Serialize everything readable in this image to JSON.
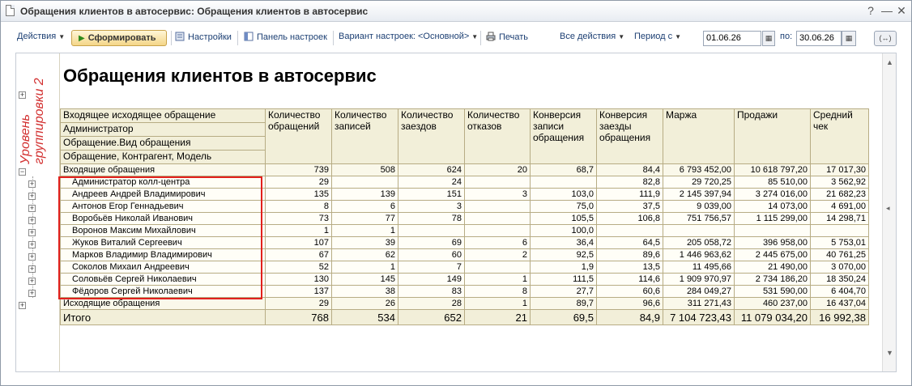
{
  "window": {
    "title": "Обращения клиентов в автосервис: Обращения клиентов в автосервис"
  },
  "toolbar": {
    "actions": "Действия",
    "form": "Сформировать",
    "settings": "Настройки",
    "panel": "Панель настроек",
    "variant": "Вариант настроек: <Основной>",
    "print": "Печать",
    "all_actions": "Все действия",
    "period_from_label": "Период с",
    "date_from": "01.06.26",
    "to_label": "по:",
    "date_to": "30.06.26"
  },
  "annotation": {
    "line1": "Уровень",
    "line2": "группировки 2"
  },
  "report": {
    "title": "Обращения клиентов в автосервис",
    "row_headers": [
      "Входящее исходящее обращение",
      "Администратор",
      "Обращение.Вид обращения",
      "Обращение, Контрагент, Модель"
    ],
    "columns": [
      "Количество обращений",
      "Количество записей",
      "Количество заездов",
      "Количество отказов",
      "Конверсия записи обращения",
      "Конверсия заезды обращения",
      "Маржа",
      "Продажи",
      "Средний чек"
    ],
    "incoming": {
      "label": "Входящие обращения",
      "values": [
        "739",
        "508",
        "624",
        "20",
        "68,7",
        "84,4",
        "6 793 452,00",
        "10 618 797,20",
        "17 017,30"
      ]
    },
    "rows": [
      {
        "label": "Администратор колл-центра",
        "values": [
          "29",
          "",
          "24",
          "",
          "",
          "82,8",
          "29 720,25",
          "85 510,00",
          "3 562,92"
        ]
      },
      {
        "label": "Андреев Андрей Владимирович",
        "values": [
          "135",
          "139",
          "151",
          "3",
          "103,0",
          "111,9",
          "2 145 397,94",
          "3 274 016,00",
          "21 682,23"
        ]
      },
      {
        "label": "Антонов Егор Геннадьевич",
        "values": [
          "8",
          "6",
          "3",
          "",
          "75,0",
          "37,5",
          "9 039,00",
          "14 073,00",
          "4 691,00"
        ]
      },
      {
        "label": "Воробьёв Николай Иванович",
        "values": [
          "73",
          "77",
          "78",
          "",
          "105,5",
          "106,8",
          "751 756,57",
          "1 115 299,00",
          "14 298,71"
        ]
      },
      {
        "label": "Воронов Максим Михайлович",
        "values": [
          "1",
          "1",
          "",
          "",
          "100,0",
          "",
          "",
          "",
          ""
        ]
      },
      {
        "label": "Жуков Виталий Сергеевич",
        "values": [
          "107",
          "39",
          "69",
          "6",
          "36,4",
          "64,5",
          "205 058,72",
          "396 958,00",
          "5 753,01"
        ]
      },
      {
        "label": "Марков Владимир Владимирович",
        "values": [
          "67",
          "62",
          "60",
          "2",
          "92,5",
          "89,6",
          "1 446 963,62",
          "2 445 675,00",
          "40 761,25"
        ]
      },
      {
        "label": "Соколов Михаил Андреевич",
        "values": [
          "52",
          "1",
          "7",
          "",
          "1,9",
          "13,5",
          "11 495,66",
          "21 490,00",
          "3 070,00"
        ]
      },
      {
        "label": "Соловьёв Сергей Николаевич",
        "values": [
          "130",
          "145",
          "149",
          "1",
          "111,5",
          "114,6",
          "1 909 970,97",
          "2 734 186,20",
          "18 350,24"
        ]
      },
      {
        "label": "Фёдоров Сергей Николаевич",
        "values": [
          "137",
          "38",
          "83",
          "8",
          "27,7",
          "60,6",
          "284 049,27",
          "531 590,00",
          "6 404,70"
        ]
      }
    ],
    "outgoing": {
      "label": "Исходящие обращения",
      "values": [
        "29",
        "26",
        "28",
        "1",
        "89,7",
        "96,6",
        "311 271,43",
        "460 237,00",
        "16 437,04"
      ]
    },
    "total": {
      "label": "Итого",
      "values": [
        "768",
        "534",
        "652",
        "21",
        "69,5",
        "84,9",
        "7 104 723,43",
        "11 079 034,20",
        "16 992,38"
      ]
    }
  }
}
